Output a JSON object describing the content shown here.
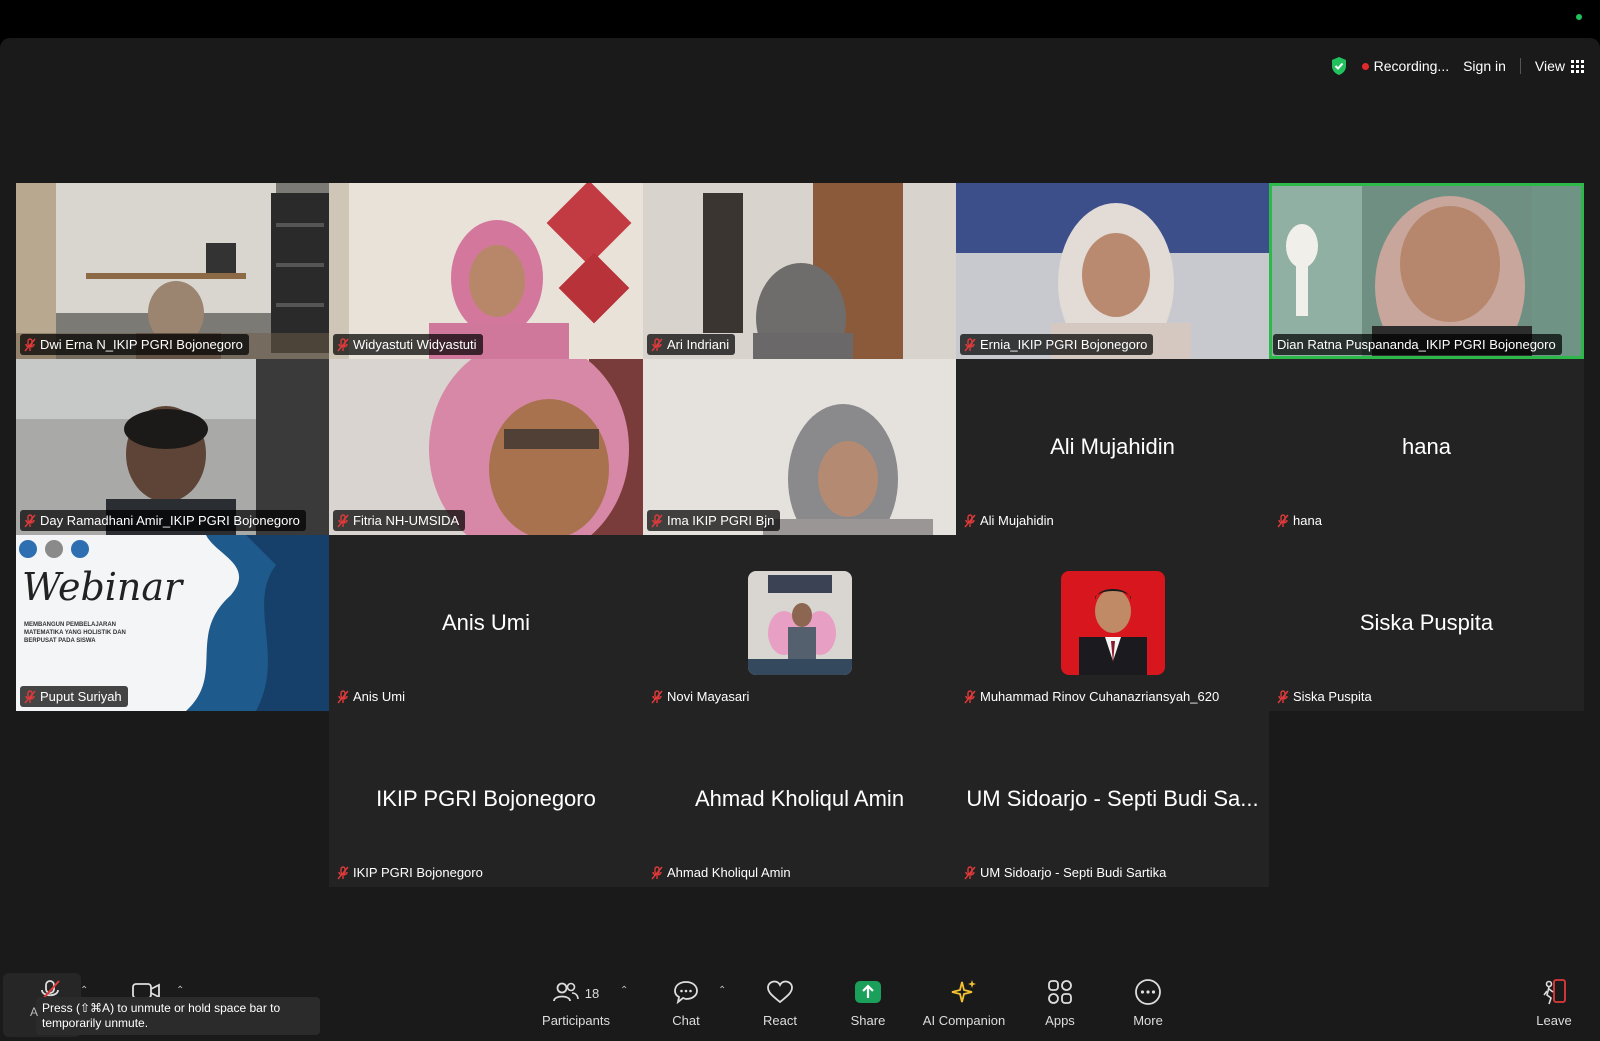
{
  "status": {
    "recording_label": "Recording...",
    "sign_in_label": "Sign in",
    "view_label": "View"
  },
  "tiles": [
    {
      "name": "Dwi Erna N_IKIP PGRI Bojonegoro"
    },
    {
      "name": "Widyastuti Widyastuti"
    },
    {
      "name": "Ari Indriani"
    },
    {
      "name": "Ernia_IKIP PGRI Bojonegoro"
    },
    {
      "name": "Dian Ratna Puspananda_IKIP PGRI Bojonegoro"
    },
    {
      "name": "Day Ramadhani Amir_IKIP PGRI Bojonegoro"
    },
    {
      "name": "Fitria NH-UMSIDA"
    },
    {
      "name": "Ima IKIP PGRI Bjn"
    },
    {
      "name": "Ali Mujahidin",
      "center": "Ali Mujahidin"
    },
    {
      "name": "hana",
      "center": "hana"
    },
    {
      "name": "Puput Suriyah",
      "slide_title": "Webinar",
      "slide_text": "MEMBANGUN PEMBELAJARAN MATEMATIKA YANG HOLISTIK DAN BERPUSAT PADA SISWA"
    },
    {
      "name": "Anis Umi",
      "center": "Anis Umi"
    },
    {
      "name": "Novi Mayasari"
    },
    {
      "name": "Muhammad Rinov Cuhanazriansyah_620"
    },
    {
      "name": "Siska Puspita",
      "center": "Siska Puspita"
    },
    {
      "name": "IKIP PGRI Bojonegoro",
      "center": "IKIP PGRI Bojonegoro"
    },
    {
      "name": "Ahmad Kholiqul Amin",
      "center": "Ahmad Kholiqul Amin"
    },
    {
      "name": "UM Sidoarjo - Septi Budi Sartika",
      "center": "UM Sidoarjo - Septi Budi Sa..."
    }
  ],
  "toolbar": {
    "participants_label": "Participants",
    "participants_count": "18",
    "chat_label": "Chat",
    "react_label": "React",
    "share_label": "Share",
    "ai_label": "AI Companion",
    "apps_label": "Apps",
    "more_label": "More",
    "leave_label": "Leave",
    "unmute_tip": "Press  (⇧⌘A) to unmute or hold space bar to temporarily unmute.",
    "unmute_tip_prefix": "A"
  },
  "colors": {
    "active_speaker": "#2db84a",
    "recording": "#e32a2a",
    "share": "#1aa05a",
    "muted_mic": "#e03a3a"
  }
}
